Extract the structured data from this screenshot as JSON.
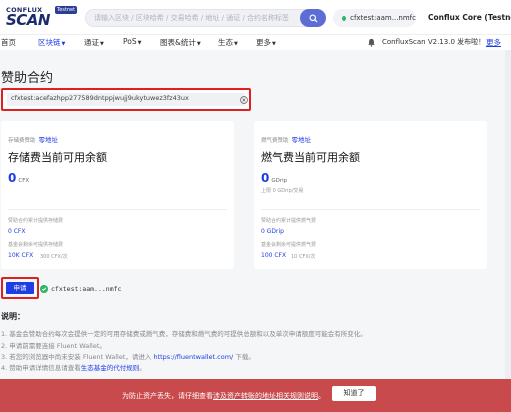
{
  "header": {
    "logo_top": "CONFLUX",
    "logo_main": "SCAN",
    "logo_badge": "Testnet",
    "search_placeholder": "请输入区块 / 区块哈希 / 交易哈希 / 地址 / 通证 / 合约名称标签",
    "account": "cfxtest:aam...nmfc",
    "network": "Conflux Core (Testnet)"
  },
  "nav": {
    "items": [
      {
        "label": "首页",
        "caret": false,
        "active": false
      },
      {
        "label": "区块链",
        "caret": true,
        "active": true
      },
      {
        "label": "通证",
        "caret": true,
        "active": false
      },
      {
        "label": "PoS",
        "caret": true,
        "active": false
      },
      {
        "label": "图表&统计",
        "caret": true,
        "active": false
      },
      {
        "label": "生态",
        "caret": true,
        "active": false
      },
      {
        "label": "更多",
        "caret": true,
        "active": false
      }
    ],
    "notice": "ConfluxScan V2.13.0 发布啦！",
    "more_right": "更多"
  },
  "page": {
    "title": "赞助合约",
    "address_value": "cfxtest:acefazhpp277589dntppjwujj9ukytuwez3fz43ux"
  },
  "storage_card": {
    "sponsor_label": "存储费赞助",
    "sponsor_link": "零地址",
    "title": "存储费当前可用余额",
    "value": "0",
    "unit": "CFX",
    "row1_label": "赞助合约累计提供存储费",
    "row1_value": "0 CFX",
    "row2_label": "基金会剩余可提供存储费",
    "row2_value": "10K CFX",
    "row2_sub": "300 CFX/次"
  },
  "gas_card": {
    "sponsor_label": "燃气费赞助",
    "sponsor_link": "零地址",
    "title": "燃气费当前可用余额",
    "value": "0",
    "unit": "GDrip",
    "note": "上限 0 GDrip/交易",
    "row1_label": "赞助合约累计提供燃气费",
    "row1_value": "0 GDrip",
    "row2_label": "基金会剩余可提供燃气费",
    "row2_value": "100 CFX",
    "row2_sub": "10 CFX/次"
  },
  "apply": {
    "button": "申请",
    "account": "cfxtest:aam...nmfc"
  },
  "description": {
    "title": "说明：",
    "line1": "1. 基金会赞助合约每次会提供一定的可用存储费或燃气费，存储费和燃气费的可提供总额和以及单次申请额度可能会有所变化。",
    "line2": "2. 申请前需要连接 Fluent Wallet。",
    "line3_a": "3. 若您的浏览器中尚未安装 Fluent Wallet，请进入",
    "line3_link": "https://fluentwallet.com/",
    "line3_b": "下载。",
    "line4_a": "4. 赞助申请详情信息请查看",
    "line4_link": "生态基金的代付规则",
    "line4_b": "。"
  },
  "toast": {
    "text_a": "为防止资产丢失，请仔细查看",
    "text_link": "涉及资产转账的地址相关规则说明",
    "text_b": "。",
    "button": "知道了"
  },
  "colors": {
    "accent": "#1e3de4",
    "highlight_border": "#e02020",
    "toast_bg": "#c94a4d",
    "success": "#2fb56b"
  }
}
